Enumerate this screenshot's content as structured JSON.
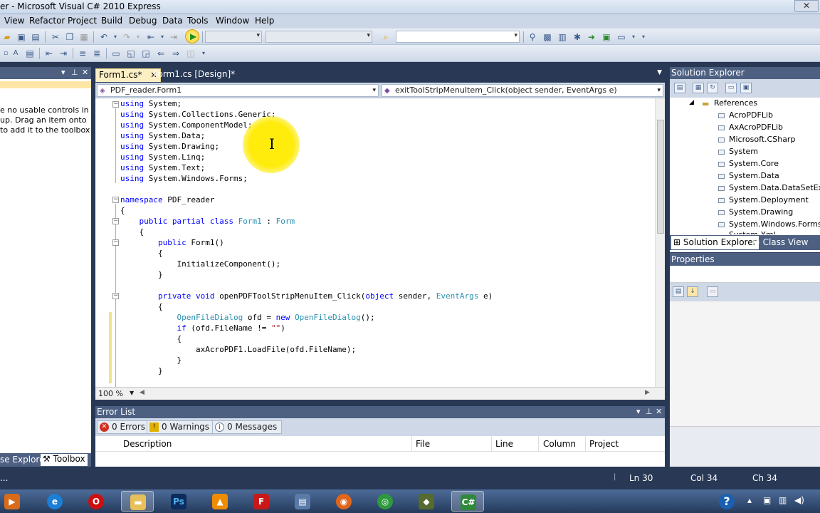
{
  "window": {
    "title": "er - Microsoft Visual C# 2010 Express",
    "close_glyph": "✕"
  },
  "menu": [
    "View",
    "Refactor",
    "Project",
    "Build",
    "Debug",
    "Data",
    "Tools",
    "Window",
    "Help"
  ],
  "toolbox": {
    "empty_text": "e no usable controls in\nup. Drag an item onto\nto add it to the toolbox.",
    "tabs": [
      "se Explorer",
      "Toolbox"
    ]
  },
  "editor": {
    "tabs": [
      "Form1.cs*",
      "Form1.cs [Design]*"
    ],
    "nav_left": "PDF_reader.Form1",
    "nav_right": "exitToolStripMenuItem_Click(object sender, EventArgs e)",
    "zoom": "100 %"
  },
  "error_list": {
    "title": "Error List",
    "filters": [
      "0 Errors",
      "0 Warnings",
      "0 Messages"
    ],
    "columns": [
      "Description",
      "File",
      "Line",
      "Column",
      "Project"
    ]
  },
  "solution_explorer": {
    "title": "Solution Explorer",
    "root": "References",
    "items": [
      "AcroPDFLib",
      "AxAcroPDFLib",
      "Microsoft.CSharp",
      "System",
      "System.Core",
      "System.Data",
      "System.Data.DataSetExten",
      "System.Deployment",
      "System.Drawing",
      "System.Windows.Forms",
      "System.Xml"
    ],
    "tabs": [
      "Solution Explorer",
      "Class View"
    ]
  },
  "properties": {
    "title": "Properties"
  },
  "status": {
    "ready": "...",
    "ln": "Ln 30",
    "col": "Col 34",
    "ch": "Ch 34"
  },
  "taskbar": {
    "apps": [
      "media-player",
      "internet-explorer",
      "opera",
      "file-explorer",
      "photoshop",
      "vlc",
      "filezilla",
      "network",
      "firefox",
      "chrome",
      "installer",
      "visual-csharp"
    ],
    "help": "?"
  },
  "colors": {
    "keyword": "#0000ff",
    "type": "#2b91af",
    "string": "#a31515",
    "panel_header": "#4d6082",
    "highlight": "#fde6a6"
  }
}
